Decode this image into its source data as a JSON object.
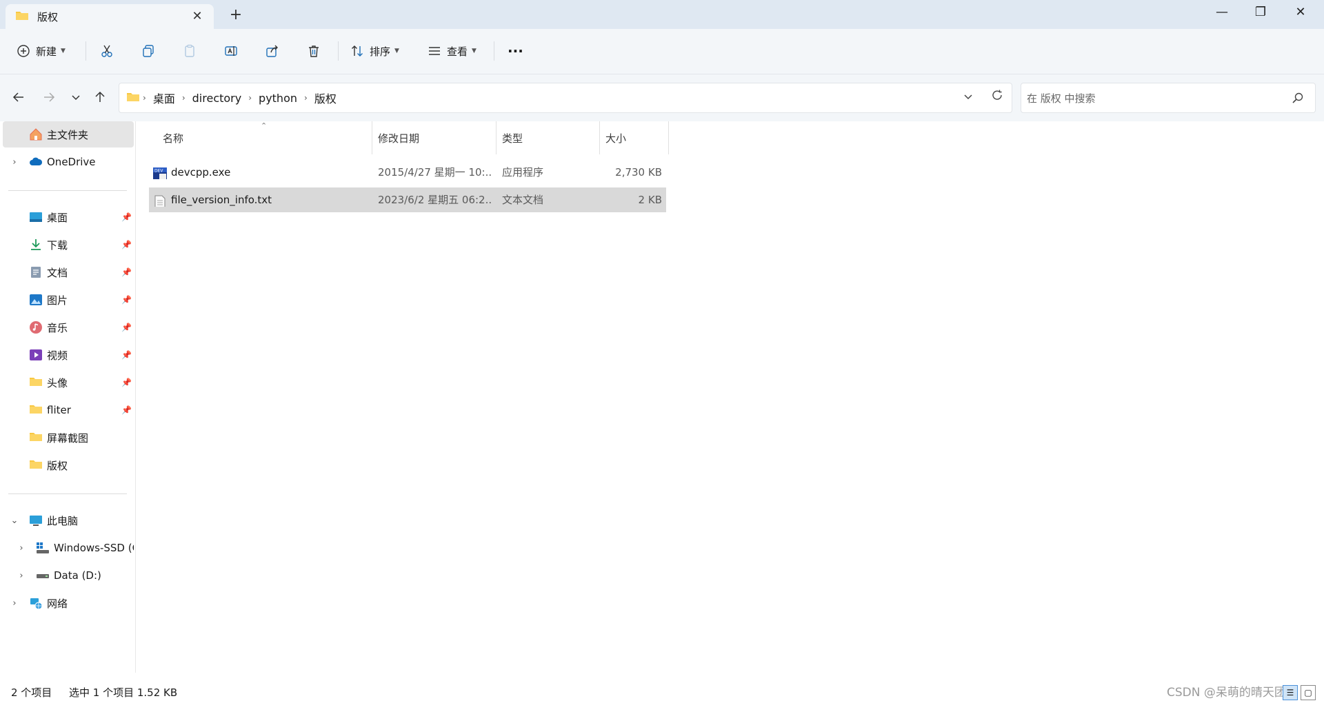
{
  "window": {
    "tab_title": "版权",
    "tab_close": "✕",
    "new_tab": "+",
    "minimize": "—",
    "maximize": "❐",
    "close": "✕"
  },
  "toolbar": {
    "new_label": "新建",
    "sort_label": "排序",
    "view_label": "查看",
    "more": "···"
  },
  "address": {
    "crumbs": [
      "桌面",
      "directory",
      "python",
      "版权"
    ]
  },
  "search": {
    "placeholder": "在 版权 中搜索"
  },
  "sidebar": {
    "home": "主文件夹",
    "onedrive": "OneDrive",
    "quick": [
      {
        "label": "桌面"
      },
      {
        "label": "下载"
      },
      {
        "label": "文档"
      },
      {
        "label": "图片"
      },
      {
        "label": "音乐"
      },
      {
        "label": "视频"
      },
      {
        "label": "头像"
      },
      {
        "label": "fliter"
      },
      {
        "label": "屏幕截图"
      },
      {
        "label": "版权"
      }
    ],
    "this_pc": "此电脑",
    "drive_c": "Windows-SSD (C:)",
    "drive_d": "Data (D:)",
    "network": "网络"
  },
  "columns": {
    "name": "名称",
    "modified": "修改日期",
    "type": "类型",
    "size": "大小"
  },
  "files": [
    {
      "name": "devcpp.exe",
      "modified": "2015/4/27 星期一 10:...",
      "type": "应用程序",
      "size": "2,730 KB"
    },
    {
      "name": "file_version_info.txt",
      "modified": "2023/6/2 星期五 06:2...",
      "type": "文本文档",
      "size": "2 KB"
    }
  ],
  "status": {
    "count": "2 个项目",
    "selection": "选中 1 个项目  1.52 KB"
  },
  "watermark": "CSDN @呆萌的晴天团她",
  "colors": {
    "accent": "#0067c0",
    "folder": "#f8c842",
    "selected_row": "#d9d9d9"
  }
}
